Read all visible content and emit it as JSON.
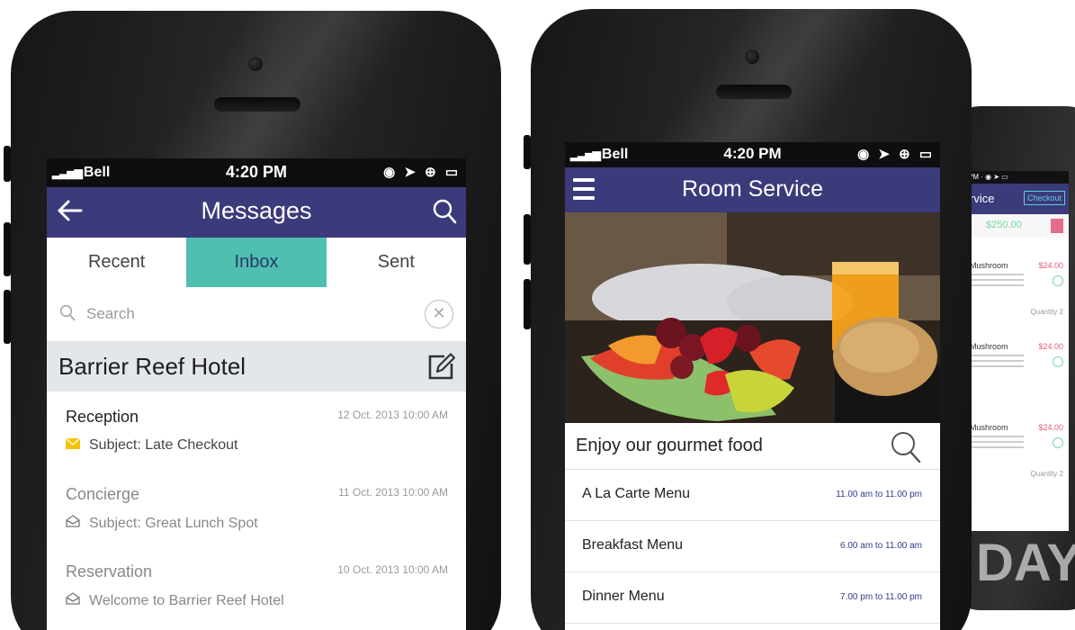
{
  "messages_app": {
    "status": {
      "carrier": "Bell",
      "time": "4:20 PM"
    },
    "header": {
      "title": "Messages",
      "back_icon": "back-arrow-icon",
      "search_icon": "search-icon"
    },
    "tabs": [
      {
        "label": "Recent",
        "active": false
      },
      {
        "label": "Inbox",
        "active": true
      },
      {
        "label": "Sent",
        "active": false
      }
    ],
    "search": {
      "placeholder": "Search"
    },
    "thread": {
      "title": "Barrier Reef Hotel",
      "compose_icon": "compose-icon"
    },
    "messages": [
      {
        "sender": "Reception",
        "date": "12 Oct. 2013 10:00 AM",
        "subject": "Subject: Late Checkout",
        "icon": "envelope-icon",
        "unread": true
      },
      {
        "sender": "Concierge",
        "date": "11 Oct. 2013 10:00 AM",
        "subject": "Subject: Great Lunch Spot",
        "icon": "open-envelope-icon",
        "unread": false
      },
      {
        "sender": "Reservation",
        "date": "10 Oct. 2013 10:00 AM",
        "subject": "Welcome to Barrier Reef Hotel",
        "icon": "open-envelope-icon",
        "unread": false
      }
    ],
    "colors": {
      "header": "#3b3a7a",
      "active_tab": "#4fbfb0",
      "unread_icon": "#f5c400"
    }
  },
  "room_service_app": {
    "status": {
      "carrier": "Bell",
      "time": "4:20 PM"
    },
    "header": {
      "title": "Room Service",
      "menu_icon": "hamburger-icon"
    },
    "banner": "Enjoy our gourmet food",
    "menus": [
      {
        "name": "A La Carte Menu",
        "hours": "11.00 am to 11.00 pm"
      },
      {
        "name": "Breakfast Menu",
        "hours": "6.00 am to 11.00 am"
      },
      {
        "name": "Dinner Menu",
        "hours": "7.00 pm to 11.00 pm"
      }
    ]
  },
  "cart_app": {
    "header": {
      "title": "rvice",
      "checkout": "Checkout"
    },
    "total": "$250.00",
    "items": [
      {
        "name": "Mushroom",
        "price": "$24.00",
        "quantity_label": "Quantity",
        "quantity": "2"
      },
      {
        "name": "Mushroom",
        "price": "$24.00",
        "quantity_label": "",
        "quantity": ""
      },
      {
        "name": "Mushroom",
        "price": "$24.00",
        "quantity_label": "Quantity",
        "quantity": "2"
      }
    ]
  }
}
